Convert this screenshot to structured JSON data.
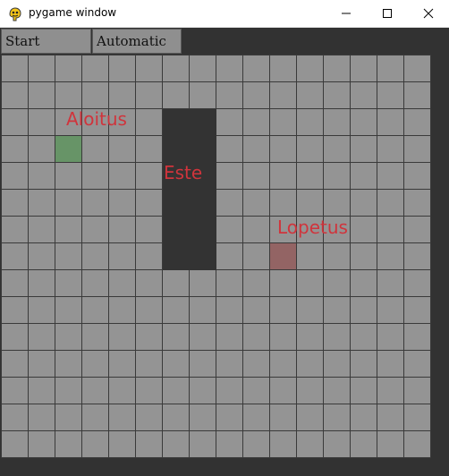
{
  "window": {
    "title": "pygame window",
    "app_icon": "pygame-snake-icon",
    "controls": {
      "minimize_icon": "minimize-icon",
      "maximize_icon": "maximize-icon",
      "close_icon": "close-icon"
    }
  },
  "toolbar": {
    "start_label": "Start",
    "automatic_label": "Automatic"
  },
  "board": {
    "columns": 16,
    "rows": 15,
    "start_cell": {
      "col": 2,
      "row": 3
    },
    "end_cell": {
      "col": 10,
      "row": 7
    },
    "obstacle_cells": {
      "col_from": 6,
      "col_to": 7,
      "row_from": 2,
      "row_to": 7
    },
    "labels": {
      "start": "Aloitus",
      "obstacle": "Este",
      "end": "Lopetus"
    }
  },
  "colors": {
    "background": "#323232",
    "cell": "#949494",
    "grid_line": "#3a3a3a",
    "obstacle": "#333333",
    "start": "#679467",
    "end": "#936464",
    "label": "#d0343c",
    "button": "#8f8f8f"
  }
}
